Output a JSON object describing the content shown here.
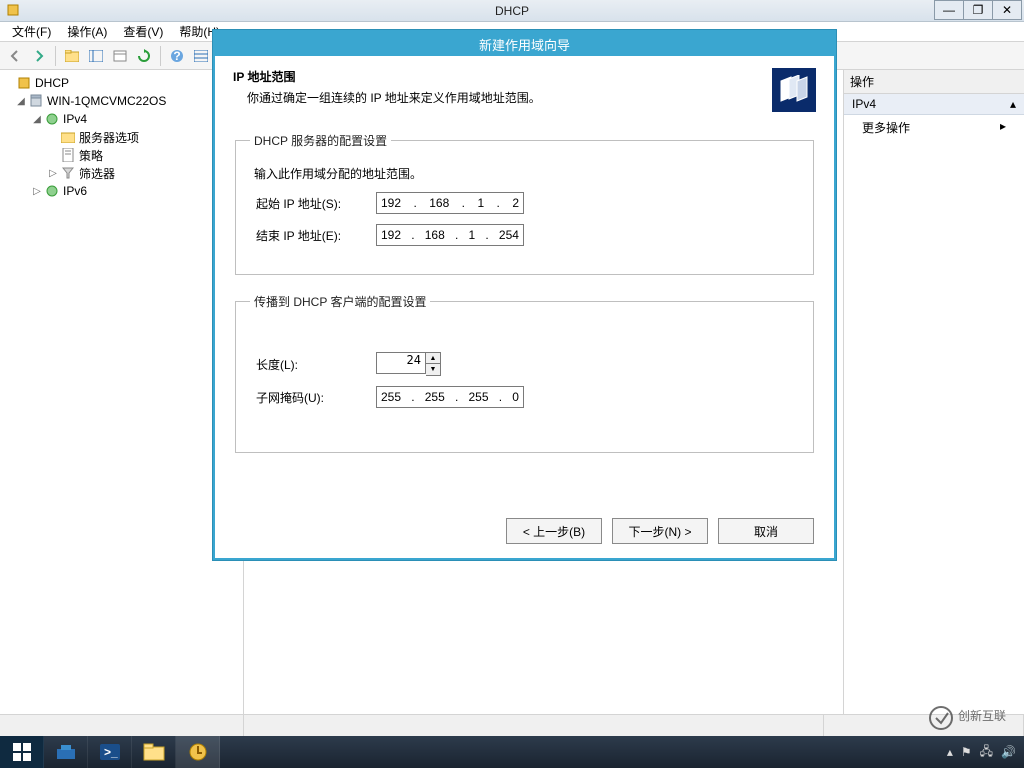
{
  "window": {
    "title": "DHCP",
    "btn_min": "—",
    "btn_max": "❐",
    "btn_close": "✕"
  },
  "menu": {
    "file": "文件(F)",
    "action": "操作(A)",
    "view": "查看(V)",
    "help": "帮助(H)"
  },
  "tree": {
    "root": "DHCP",
    "server": "WIN-1QMCVMC22OS",
    "ipv4": "IPv4",
    "server_options": "服务器选项",
    "policies": "策略",
    "filters": "筛选器",
    "ipv6": "IPv6"
  },
  "actions": {
    "header": "操作",
    "section": "IPv4",
    "more": "更多操作"
  },
  "dialog": {
    "title": "新建作用域向导",
    "head_title": "IP 地址范围",
    "head_sub": "你通过确定一组连续的 IP 地址来定义作用域地址范围。",
    "fs1_legend": "DHCP 服务器的配置设置",
    "fs1_prompt": "输入此作用域分配的地址范围。",
    "start_ip_label": "起始 IP 地址(S):",
    "start_ip": {
      "a": "192",
      "b": "168",
      "c": "1",
      "d": "2"
    },
    "end_ip_label": "结束 IP 地址(E):",
    "end_ip": {
      "a": "192",
      "b": "168",
      "c": "1",
      "d": "254"
    },
    "fs2_legend": "传播到 DHCP 客户端的配置设置",
    "length_label": "长度(L):",
    "length_value": "24",
    "mask_label": "子网掩码(U):",
    "mask": {
      "a": "255",
      "b": "255",
      "c": "255",
      "d": "0"
    },
    "btn_back": "< 上一步(B)",
    "btn_next": "下一步(N) >",
    "btn_cancel": "取消"
  },
  "watermark": "创新互联"
}
